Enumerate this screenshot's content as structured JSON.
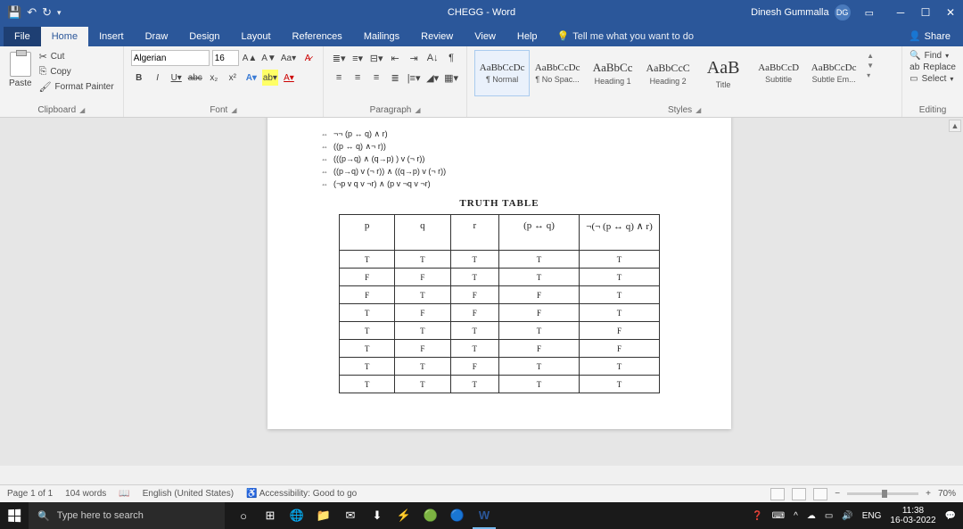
{
  "title": "CHEGG  -  Word",
  "user": {
    "name": "Dinesh Gummalla",
    "initials": "DG"
  },
  "tabs": [
    "File",
    "Home",
    "Insert",
    "Draw",
    "Design",
    "Layout",
    "References",
    "Mailings",
    "Review",
    "View",
    "Help"
  ],
  "tell_me": "Tell me what you want to do",
  "share": "Share",
  "clipboard": {
    "paste": "Paste",
    "cut": "Cut",
    "copy": "Copy",
    "format_painter": "Format Painter",
    "label": "Clipboard"
  },
  "font": {
    "name": "Algerian",
    "size": "16",
    "label": "Font"
  },
  "paragraph": {
    "label": "Paragraph"
  },
  "styles": {
    "label": "Styles",
    "items": [
      {
        "sample": "AaBbCcDc",
        "name": "¶ Normal",
        "size": "11px"
      },
      {
        "sample": "AaBbCcDc",
        "name": "¶ No Spac...",
        "size": "11px"
      },
      {
        "sample": "AaBbCc",
        "name": "Heading 1",
        "size": "13px"
      },
      {
        "sample": "AaBbCcC",
        "name": "Heading 2",
        "size": "12px"
      },
      {
        "sample": "AaB",
        "name": "Title",
        "size": "20px"
      },
      {
        "sample": "AaBbCcD",
        "name": "Subtitle",
        "size": "11px"
      },
      {
        "sample": "AaBbCcDc",
        "name": "Subtle Em...",
        "size": "11px"
      }
    ]
  },
  "editing": {
    "find": "Find",
    "replace": "Replace",
    "select": "Select",
    "label": "Editing"
  },
  "document": {
    "formulas": [
      "¬¬ (p ↔ q) ∧ r)",
      "((p ↔ q) ∧¬ r))",
      "(((p→q) ∧ (q→p) ) v (¬ r))",
      "((p→q) v (¬ r))  ∧  ((q→p) v (¬ r))",
      "(¬p v q v ¬r) ∧  (p v ¬q v ¬r)"
    ],
    "truth_title": "TRUTH TABLE",
    "headers": [
      "p",
      "q",
      "r",
      "(p ↔ q)",
      "¬(¬ (p ↔ q) ∧ r)"
    ],
    "rows": [
      [
        "T",
        "T",
        "T",
        "T",
        "T"
      ],
      [
        "F",
        "F",
        "T",
        "T",
        "T"
      ],
      [
        "F",
        "T",
        "F",
        "F",
        "T"
      ],
      [
        "T",
        "F",
        "F",
        "F",
        "T"
      ],
      [
        "T",
        "T",
        "T",
        "T",
        "F"
      ],
      [
        "T",
        "F",
        "T",
        "F",
        "F"
      ],
      [
        "T",
        "T",
        "F",
        "T",
        "T"
      ],
      [
        "T",
        "T",
        "T",
        "T",
        "T"
      ]
    ]
  },
  "status": {
    "page": "Page 1 of 1",
    "words": "104 words",
    "lang": "English (United States)",
    "accessibility": "Accessibility: Good to go",
    "zoom": "70%"
  },
  "taskbar": {
    "search_placeholder": "Type here to search",
    "clock_time": "11:38",
    "clock_date": "16-03-2022",
    "lang": "ENG"
  }
}
